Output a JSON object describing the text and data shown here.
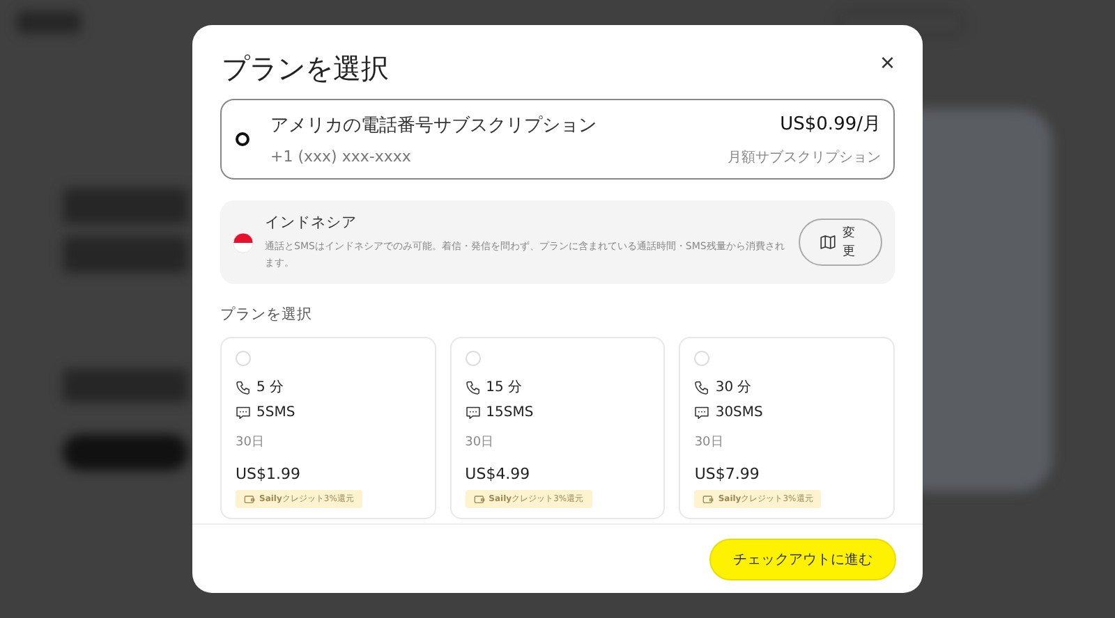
{
  "dialog": {
    "title": "プランを選択",
    "close": "×"
  },
  "subscription": {
    "name": "アメリカの電話番号サブスクリプション",
    "number": "+1 (xxx) xxx-xxxx",
    "price": "US$0.99/月",
    "period": "月額サブスクリプション",
    "selected": true
  },
  "country": {
    "name": "インドネシア",
    "note": "通話とSMSはインドネシアでのみ可能。着信・発信を問わず、プランに含まれている通話時間・SMS残量から消費されます。",
    "change_button": "変更"
  },
  "plans_heading": "プランを選択",
  "plans": [
    {
      "minutes": "5 分",
      "sms": "5SMS",
      "validity": "30日",
      "price": "US$1.99",
      "badge": "**Saily**クレジット3%還元",
      "selected": false
    },
    {
      "minutes": "15 分",
      "sms": "15SMS",
      "validity": "30日",
      "price": "US$4.99",
      "badge": "**Saily**クレジット3%還元",
      "selected": false
    },
    {
      "minutes": "30 分",
      "sms": "30SMS",
      "validity": "30日",
      "price": "US$7.99",
      "badge": "**Saily**クレジット3%還元",
      "selected": false
    }
  ],
  "checkout_button": "チェックアウトに進む"
}
